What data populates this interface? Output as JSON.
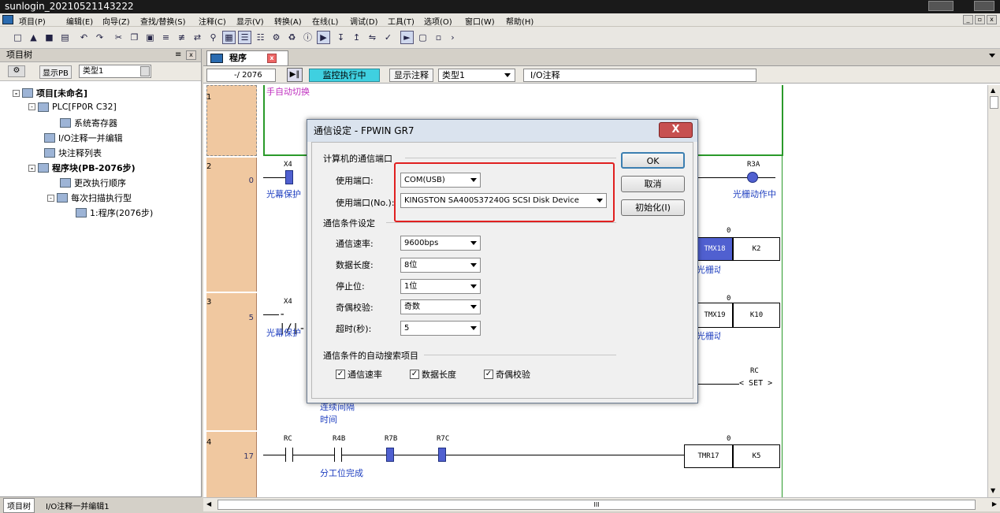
{
  "window": {
    "title": "sunlogin_20210521143222"
  },
  "menu": [
    "项目(P)",
    "编辑(E)",
    "向导(Z)",
    "查找/替换(S)",
    "注释(C)",
    "显示(V)",
    "转换(A)",
    "在线(L)",
    "调试(D)",
    "工具(T)",
    "选项(O)",
    "窗口(W)",
    "帮助(H)"
  ],
  "project_tree": {
    "header": "项目树",
    "pin_glyph": "≡",
    "close_glyph": "x",
    "toolbar_show_pb": "显示PB",
    "toolbar_type": "类型1",
    "items": [
      {
        "label": "项目[未命名]",
        "bold": true
      },
      {
        "label": "PLC[FP0R C32]",
        "bold": false
      },
      {
        "label": "系统寄存器",
        "bold": false
      },
      {
        "label": "I/O注释一并编辑",
        "bold": false
      },
      {
        "label": "块注释列表",
        "bold": false
      },
      {
        "label": "程序块(PB-2076步)",
        "bold": true
      },
      {
        "label": "更改执行顺序",
        "bold": false
      },
      {
        "label": "每次扫描执行型",
        "bold": false
      },
      {
        "label": "1:程序(2076步)",
        "bold": false
      }
    ],
    "bottom_tabs": [
      "项目树",
      "I/O注释一并编辑1"
    ]
  },
  "editor": {
    "tab_label": "程序",
    "tab_close": "x",
    "step_display": "-/ 2076",
    "monitor_status": "监控执行中",
    "show_comment": "显示注释",
    "comment_type": "类型1",
    "io_comment": "I/O注释",
    "hscroll_mid": "III"
  },
  "ladder": {
    "rungs": [
      {
        "num": "1",
        "step": "",
        "comment": "手自动切换"
      },
      {
        "num": "2",
        "step": "0",
        "contact": "X4",
        "contact_comment": "光幕保护",
        "coil": "R3A",
        "coil_comment": "光栅动作中",
        "tmx": "TMX18",
        "tmx_val": "K2",
        "tmx_comment": "光栅动作时间间隔",
        "zero": "0"
      },
      {
        "num": "3",
        "step": "5",
        "contact": "X4",
        "contact_comment": "光幕保护",
        "tmx": "TMX19",
        "tmx_val": "K10",
        "tmx_comment": "光栅动作时间间隔",
        "coil": "RC",
        "coil_set": "SET",
        "extra_comment": "连续间隔时间",
        "zero": "0"
      },
      {
        "num": "4",
        "step": "17",
        "contacts": [
          "RC",
          "R4B",
          "R7B",
          "R7C"
        ],
        "contacts_comment": "分工位完成",
        "tmr": "TMR17",
        "tmr_val": "K5",
        "zero": "0"
      }
    ]
  },
  "dialog": {
    "title": "通信设定 - FPWIN GR7",
    "close_glyph": "X",
    "group1": "计算机的通信端口",
    "port_label": "使用端口:",
    "port_value": "COM(USB)",
    "port_no_label": "使用端口(No.):",
    "port_no_value": "KINGSTON SA400S37240G SCSI Disk Device",
    "group2": "通信条件设定",
    "baud_label": "通信速率:",
    "baud_value": "9600bps",
    "datalen_label": "数据长度:",
    "datalen_value": "8位",
    "stopbit_label": "停止位:",
    "stopbit_value": "1位",
    "parity_label": "奇偶校验:",
    "parity_value": "奇数",
    "timeout_label": "超时(秒):",
    "timeout_value": "5",
    "group3": "通信条件的自动搜索项目",
    "chk_baud": "通信速率",
    "chk_datalen": "数据长度",
    "chk_parity": "奇偶校验",
    "chk_glyph": "✓",
    "btn_ok": "OK",
    "btn_cancel": "取消",
    "btn_init": "初始化(I)"
  },
  "colors": {
    "highlight": "#e02020",
    "monitor": "#3fd0e0",
    "rung_label": "#f0c8a0",
    "contact": "#5060d0"
  }
}
